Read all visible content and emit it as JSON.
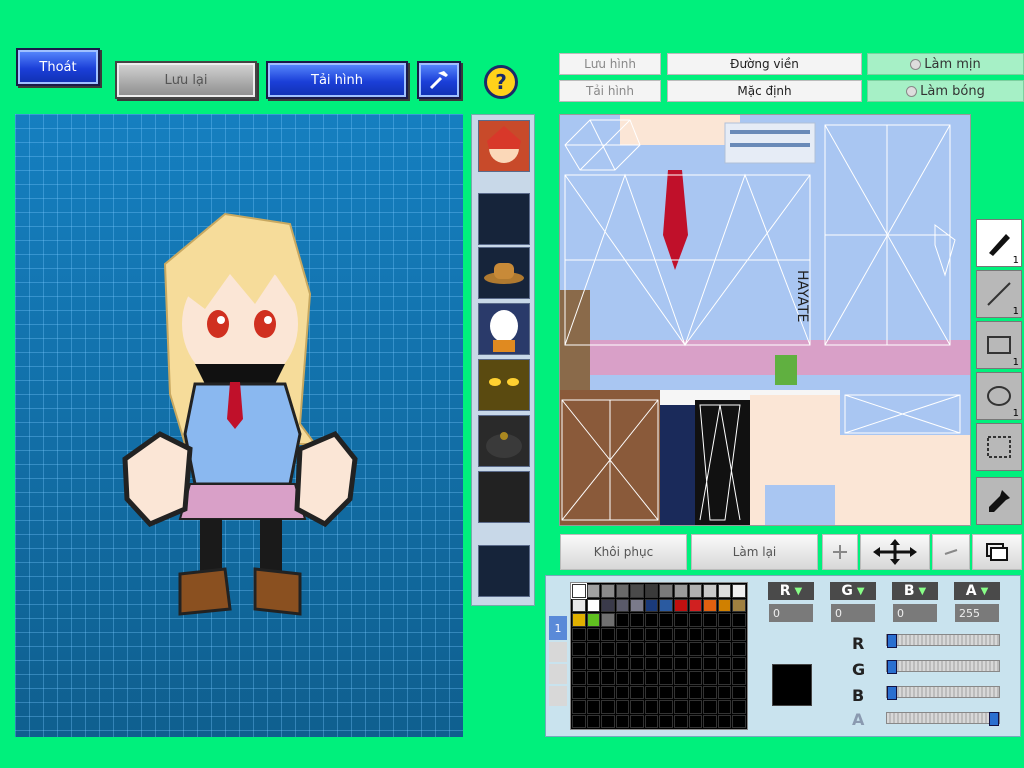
{
  "toolbar": {
    "exit_label": "Thoát",
    "save_label": "Lưu lại",
    "reload_label": "Tải hình",
    "help_icon": "question-icon",
    "hammer_icon": "hammer-icon"
  },
  "texture_panel": {
    "save_image_label": "Lưu hình",
    "load_image_label": "Tải hình",
    "outline_label": "Đường viền",
    "default_label": "Mặc định",
    "smooth_label": "Làm mịn",
    "shade_label": "Làm bóng",
    "texture_signature": "HAYATE"
  },
  "tools": [
    {
      "name": "pen-tool",
      "number": "1"
    },
    {
      "name": "line-tool",
      "number": "1"
    },
    {
      "name": "rect-tool",
      "number": "1"
    },
    {
      "name": "ellipse-tool",
      "number": "1"
    },
    {
      "name": "select-tool",
      "number": ""
    },
    {
      "name": "eyedropper-tool",
      "number": ""
    }
  ],
  "actions": {
    "restore_label": "Khôi phục",
    "redo_label": "Làm lại"
  },
  "palette": {
    "tab_number": "1",
    "swatches": [
      "#ffffff",
      "#a0a0a0",
      "#8a8a8a",
      "#6a6a6a",
      "#4a4a4a",
      "#3a3a3a",
      "#7a7a7a",
      "#9a9a9a",
      "#b0b0b0",
      "#c8c8c8",
      "#dcdcdc",
      "#f0f0f0",
      "#e8e8e8",
      "#ffffff",
      "#3a3a4a",
      "#5a5a6a",
      "#7a7a8a",
      "#1a3a7a",
      "#2a5aa0",
      "#c01010",
      "#d02020",
      "#e06010",
      "#d08000",
      "#a08040",
      "#e0b000",
      "#60c020",
      "#707070"
    ],
    "current_color": "#000000",
    "r_label": "R",
    "g_label": "G",
    "b_label": "B",
    "a_label": "A",
    "r_value": "0",
    "g_value": "0",
    "b_value": "0",
    "a_value": "255",
    "r_level": 0,
    "g_level": 0,
    "b_level": 0,
    "a_level": 1.0
  },
  "colors": {
    "background": "#00f07c",
    "blue_button": "#1b3fd8",
    "canvas": "#1781b8"
  }
}
